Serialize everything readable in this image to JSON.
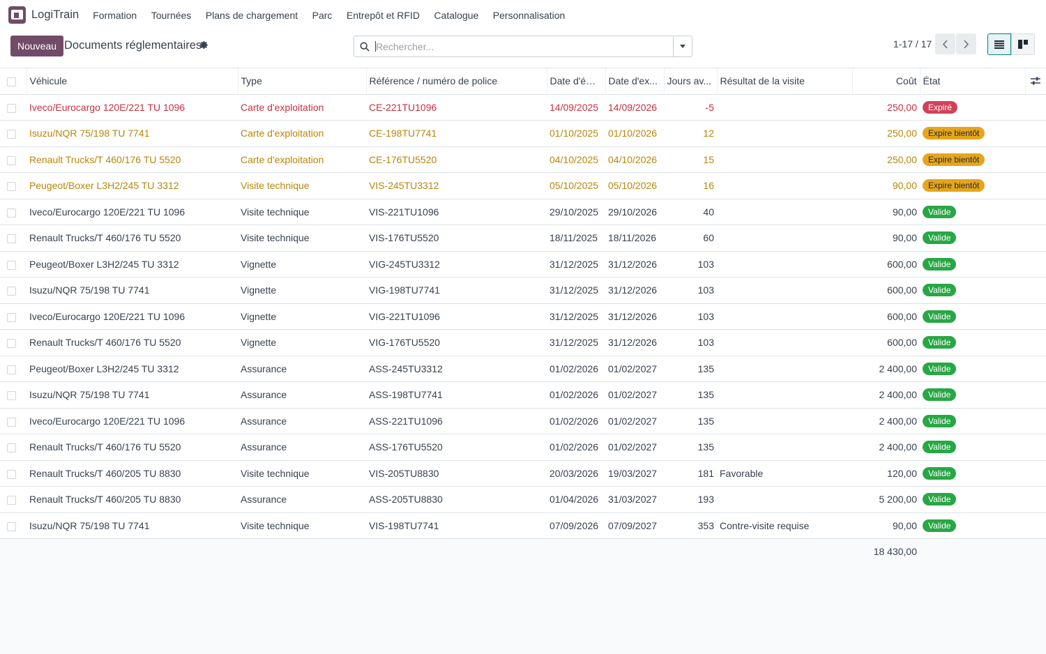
{
  "app": {
    "name": "LogiTrain"
  },
  "menu": [
    "Formation",
    "Tournées",
    "Plans de chargement",
    "Parc",
    "Entrepôt et RFID",
    "Catalogue",
    "Personnalisation"
  ],
  "control": {
    "new_label": "Nouveau",
    "title": "Documents réglementaires",
    "search_placeholder": "Rechercher...",
    "pager": "1-17 / 17"
  },
  "columns": {
    "vehicle": "Véhicule",
    "type": "Type",
    "ref": "Référence / numéro de police",
    "issue": "Date d'ém...",
    "expiry": "Date d'ex...",
    "days": "Jours av...",
    "result": "Résultat de la visite",
    "cost": "Coût",
    "state": "État"
  },
  "rows": [
    {
      "vehicle": "Iveco/Eurocargo 120E/221 TU 1096",
      "type": "Carte d'exploitation",
      "ref": "CE-221TU1096",
      "issue": "14/09/2025",
      "expiry": "14/09/2026",
      "days": "-5",
      "result": "",
      "cost": "250,00",
      "state": "Expiré",
      "tone": "expired"
    },
    {
      "vehicle": "Isuzu/NQR 75/198 TU 7741",
      "type": "Carte d'exploitation",
      "ref": "CE-198TU7741",
      "issue": "01/10/2025",
      "expiry": "01/10/2026",
      "days": "12",
      "result": "",
      "cost": "250,00",
      "state": "Expire bientôt",
      "tone": "soon"
    },
    {
      "vehicle": "Renault Trucks/T 460/176 TU 5520",
      "type": "Carte d'exploitation",
      "ref": "CE-176TU5520",
      "issue": "04/10/2025",
      "expiry": "04/10/2026",
      "days": "15",
      "result": "",
      "cost": "250,00",
      "state": "Expire bientôt",
      "tone": "soon"
    },
    {
      "vehicle": "Peugeot/Boxer L3H2/245 TU 3312",
      "type": "Visite technique",
      "ref": "VIS-245TU3312",
      "issue": "05/10/2025",
      "expiry": "05/10/2026",
      "days": "16",
      "result": "",
      "cost": "90,00",
      "state": "Expire bientôt",
      "tone": "soon"
    },
    {
      "vehicle": "Iveco/Eurocargo 120E/221 TU 1096",
      "type": "Visite technique",
      "ref": "VIS-221TU1096",
      "issue": "29/10/2025",
      "expiry": "29/10/2026",
      "days": "40",
      "result": "",
      "cost": "90,00",
      "state": "Valide",
      "tone": "ok"
    },
    {
      "vehicle": "Renault Trucks/T 460/176 TU 5520",
      "type": "Visite technique",
      "ref": "VIS-176TU5520",
      "issue": "18/11/2025",
      "expiry": "18/11/2026",
      "days": "60",
      "result": "",
      "cost": "90,00",
      "state": "Valide",
      "tone": "ok"
    },
    {
      "vehicle": "Peugeot/Boxer L3H2/245 TU 3312",
      "type": "Vignette",
      "ref": "VIG-245TU3312",
      "issue": "31/12/2025",
      "expiry": "31/12/2026",
      "days": "103",
      "result": "",
      "cost": "600,00",
      "state": "Valide",
      "tone": "ok"
    },
    {
      "vehicle": "Isuzu/NQR 75/198 TU 7741",
      "type": "Vignette",
      "ref": "VIG-198TU7741",
      "issue": "31/12/2025",
      "expiry": "31/12/2026",
      "days": "103",
      "result": "",
      "cost": "600,00",
      "state": "Valide",
      "tone": "ok"
    },
    {
      "vehicle": "Iveco/Eurocargo 120E/221 TU 1096",
      "type": "Vignette",
      "ref": "VIG-221TU1096",
      "issue": "31/12/2025",
      "expiry": "31/12/2026",
      "days": "103",
      "result": "",
      "cost": "600,00",
      "state": "Valide",
      "tone": "ok"
    },
    {
      "vehicle": "Renault Trucks/T 460/176 TU 5520",
      "type": "Vignette",
      "ref": "VIG-176TU5520",
      "issue": "31/12/2025",
      "expiry": "31/12/2026",
      "days": "103",
      "result": "",
      "cost": "600,00",
      "state": "Valide",
      "tone": "ok"
    },
    {
      "vehicle": "Peugeot/Boxer L3H2/245 TU 3312",
      "type": "Assurance",
      "ref": "ASS-245TU3312",
      "issue": "01/02/2026",
      "expiry": "01/02/2027",
      "days": "135",
      "result": "",
      "cost": "2 400,00",
      "state": "Valide",
      "tone": "ok"
    },
    {
      "vehicle": "Isuzu/NQR 75/198 TU 7741",
      "type": "Assurance",
      "ref": "ASS-198TU7741",
      "issue": "01/02/2026",
      "expiry": "01/02/2027",
      "days": "135",
      "result": "",
      "cost": "2 400,00",
      "state": "Valide",
      "tone": "ok"
    },
    {
      "vehicle": "Iveco/Eurocargo 120E/221 TU 1096",
      "type": "Assurance",
      "ref": "ASS-221TU1096",
      "issue": "01/02/2026",
      "expiry": "01/02/2027",
      "days": "135",
      "result": "",
      "cost": "2 400,00",
      "state": "Valide",
      "tone": "ok"
    },
    {
      "vehicle": "Renault Trucks/T 460/176 TU 5520",
      "type": "Assurance",
      "ref": "ASS-176TU5520",
      "issue": "01/02/2026",
      "expiry": "01/02/2027",
      "days": "135",
      "result": "",
      "cost": "2 400,00",
      "state": "Valide",
      "tone": "ok"
    },
    {
      "vehicle": "Renault Trucks/T 460/205 TU 8830",
      "type": "Visite technique",
      "ref": "VIS-205TU8830",
      "issue": "20/03/2026",
      "expiry": "19/03/2027",
      "days": "181",
      "result": "Favorable",
      "cost": "120,00",
      "state": "Valide",
      "tone": "ok"
    },
    {
      "vehicle": "Renault Trucks/T 460/205 TU 8830",
      "type": "Assurance",
      "ref": "ASS-205TU8830",
      "issue": "01/04/2026",
      "expiry": "31/03/2027",
      "days": "193",
      "result": "",
      "cost": "5 200,00",
      "state": "Valide",
      "tone": "ok"
    },
    {
      "vehicle": "Isuzu/NQR 75/198 TU 7741",
      "type": "Visite technique",
      "ref": "VIS-198TU7741",
      "issue": "07/09/2026",
      "expiry": "07/09/2027",
      "days": "353",
      "result": "Contre-visite requise",
      "cost": "90,00",
      "state": "Valide",
      "tone": "ok"
    }
  ],
  "total_cost": "18 430,00",
  "colors": {
    "brand": "#714b67",
    "expired": "#c9303f",
    "soon": "#b8860b",
    "valid": "#28a745",
    "active_view": "#017e84"
  },
  "icons": [
    "app-logo-icon",
    "gear-icon",
    "search-icon",
    "caret-down-icon",
    "chevron-left-icon",
    "chevron-right-icon",
    "list-view-icon",
    "kanban-view-icon",
    "optional-columns-icon"
  ]
}
